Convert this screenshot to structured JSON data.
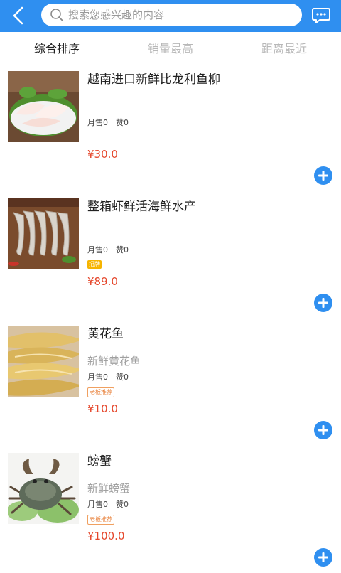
{
  "header": {
    "back_icon": "chevron-left-icon",
    "search_placeholder": "搜索您感兴趣的内容",
    "message_icon": "chat-bubble-icon",
    "background": "#2f8ff0"
  },
  "tabs": [
    {
      "label": "综合排序",
      "active": true
    },
    {
      "label": "销量最高",
      "active": false
    },
    {
      "label": "距离最近",
      "active": false
    }
  ],
  "products": [
    {
      "title": "越南进口新鲜比龙利鱼柳",
      "subtitle": "",
      "sold": "月售0",
      "likes": "赞0",
      "badge": "",
      "price": "¥30.0",
      "image": "fish-fillet-image"
    },
    {
      "title": "整箱虾鲜活海鲜水产",
      "subtitle": "",
      "sold": "月售0",
      "likes": "赞0",
      "badge": "招牌",
      "price": "¥89.0",
      "image": "shrimp-image"
    },
    {
      "title": "黄花鱼",
      "subtitle": "新鲜黄花鱼",
      "sold": "月售0",
      "likes": "赞0",
      "badge": "老板推荐",
      "price": "¥10.0",
      "image": "yellow-croaker-image"
    },
    {
      "title": "螃蟹",
      "subtitle": "新鲜螃蟹",
      "sold": "月售0",
      "likes": "赞0",
      "badge": "老板推荐",
      "price": "¥100.0",
      "image": "crab-image"
    }
  ],
  "colors": {
    "accent": "#2f8ff0",
    "price": "#e5482d",
    "badge_solid": "#f6b400",
    "badge_outline": "#e8803a"
  }
}
